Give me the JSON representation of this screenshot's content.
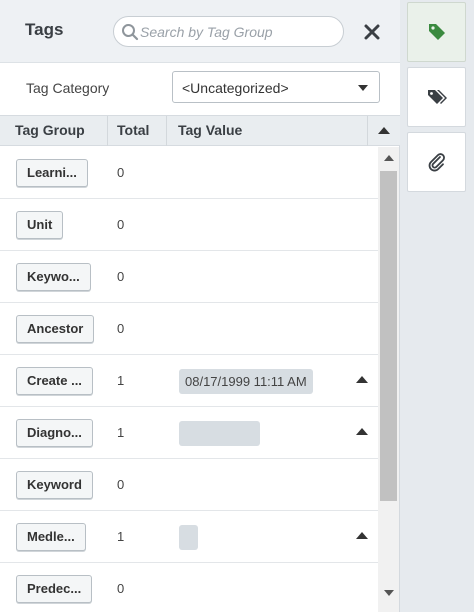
{
  "header": {
    "title": "Tags",
    "search_placeholder": "Search by Tag Group",
    "close_label": "close"
  },
  "category": {
    "label": "Tag Category",
    "selected": "<Uncategorized>"
  },
  "table": {
    "columns": [
      "Tag Group",
      "Total",
      "Tag Value"
    ],
    "rows": [
      {
        "group": "Learni...",
        "total": "0",
        "value": ""
      },
      {
        "group": "Unit",
        "total": "0",
        "value": ""
      },
      {
        "group": "Keywo...",
        "total": "0",
        "value": ""
      },
      {
        "group": "Ancestor",
        "total": "0",
        "value": ""
      },
      {
        "group": "Create ...",
        "total": "1",
        "value": "08/17/1999 11:11 AM"
      },
      {
        "group": "Diagno...",
        "total": "1",
        "value": "                   "
      },
      {
        "group": "Keyword",
        "total": "0",
        "value": ""
      },
      {
        "group": "Medle...",
        "total": "1",
        "value": "  "
      },
      {
        "group": "Predec...",
        "total": "0",
        "value": ""
      }
    ]
  },
  "rail": {
    "tabs": [
      "tag-icon",
      "tags-icon",
      "paperclip-icon"
    ]
  },
  "colors": {
    "accent_green": "#3a8a3f",
    "header_bg": "#eef1f4",
    "chip_bg": "#d7dde2"
  }
}
